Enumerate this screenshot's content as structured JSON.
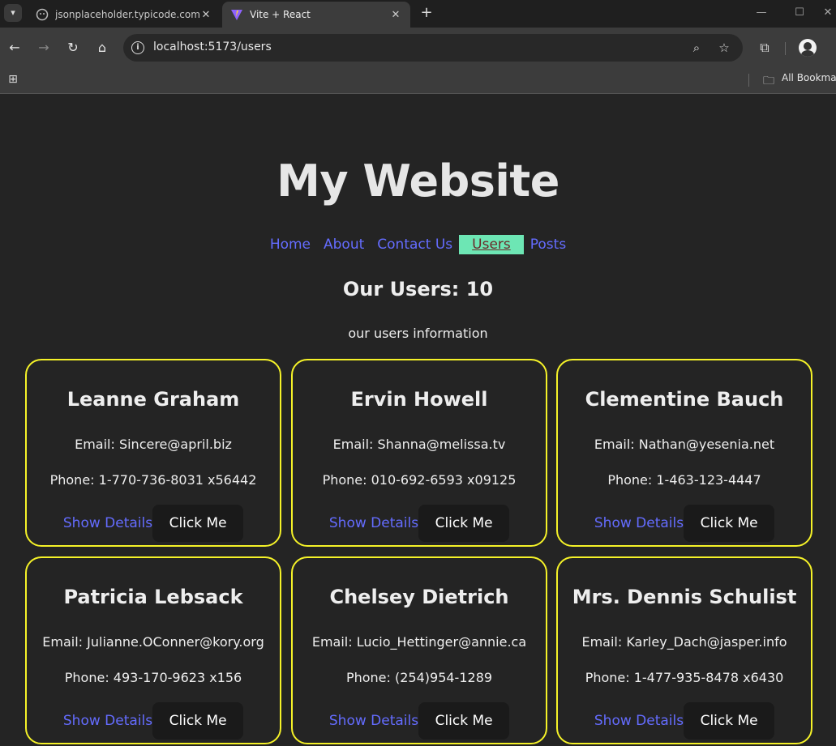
{
  "browser": {
    "tabs": [
      {
        "title": "jsonplaceholder.typicode.com/p",
        "active": false
      },
      {
        "title": "Vite + React",
        "active": true
      }
    ],
    "url": "localhost:5173/users",
    "bookmarks_label": "All Bookmarks",
    "icons": {
      "tab_menu": "chevron-down-icon",
      "close": "close-icon",
      "new_tab": "plus-icon",
      "back": "back-arrow-icon",
      "forward": "forward-arrow-icon",
      "reload": "reload-icon",
      "home": "home-icon",
      "info": "info-icon",
      "zoom": "zoom-icon",
      "star": "star-icon",
      "extensions": "puzzle-icon",
      "apps": "apps-grid-icon",
      "folder": "folder-icon"
    }
  },
  "site": {
    "title": "My Website",
    "nav": [
      "Home",
      "About",
      "Contact Us",
      "Users",
      "Posts"
    ],
    "active_nav": "Users",
    "users_heading": "Our Users: 10",
    "users_subheading": "our users information"
  },
  "users": [
    {
      "name": "Leanne Graham",
      "email": "Email: Sincere@april.biz",
      "phone": "Phone: 1-770-736-8031 x56442"
    },
    {
      "name": "Ervin Howell",
      "email": "Email: Shanna@melissa.tv",
      "phone": "Phone: 010-692-6593 x09125"
    },
    {
      "name": "Clementine Bauch",
      "email": "Email: Nathan@yesenia.net",
      "phone": "Phone: 1-463-123-4447"
    },
    {
      "name": "Patricia Lebsack",
      "email": "Email: Julianne.OConner@kory.org",
      "phone": "Phone: 493-170-9623 x156"
    },
    {
      "name": "Chelsey Dietrich",
      "email": "Email: Lucio_Hettinger@annie.ca",
      "phone": "Phone: (254)954-1289"
    },
    {
      "name": "Mrs. Dennis Schulist",
      "email": "Email: Karley_Dach@jasper.info",
      "phone": "Phone: 1-477-935-8478 x6430"
    }
  ],
  "card_actions": {
    "details_label": "Show Details",
    "button_label": "Click Me"
  },
  "colors": {
    "card_border": "#f5f228",
    "link": "#646cff",
    "active_nav_bg": "#6de6b4",
    "page_bg": "#242424"
  }
}
